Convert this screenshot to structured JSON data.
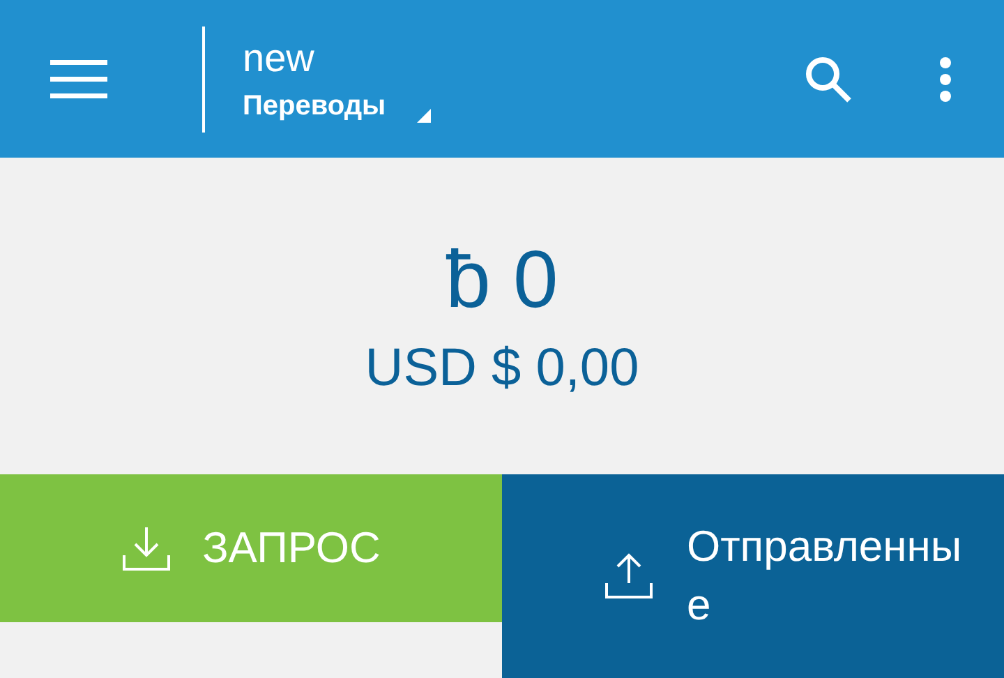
{
  "app_bar": {
    "title": "new",
    "subtitle": "Переводы"
  },
  "balance": {
    "amount": "ƀ 0",
    "fiat": "USD $ 0,00"
  },
  "actions": [
    {
      "kind": "request",
      "label": "ЗАПРОС"
    },
    {
      "kind": "sent",
      "label": "Отправленные"
    }
  ]
}
